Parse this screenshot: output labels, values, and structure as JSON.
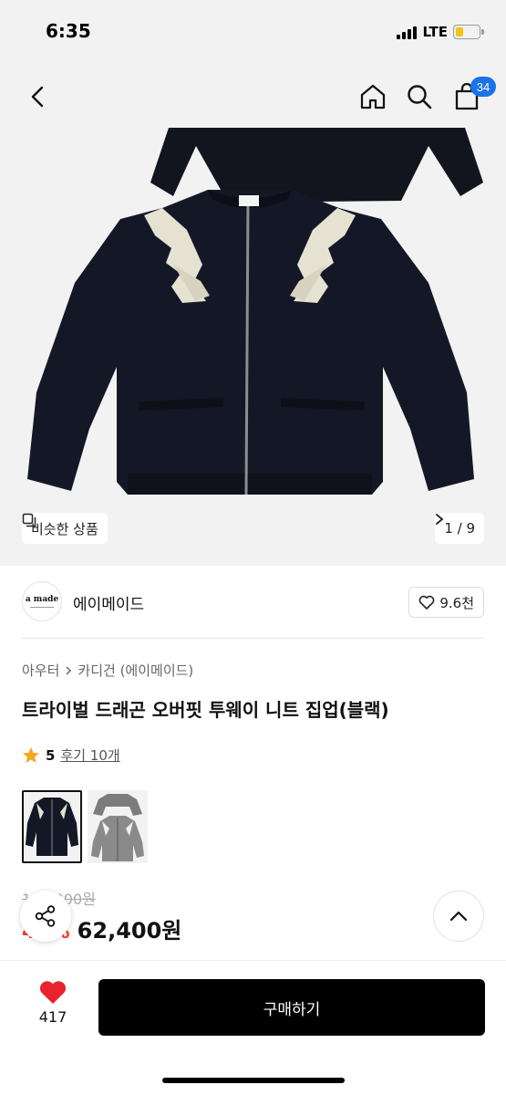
{
  "status_bar": {
    "time": "6:35",
    "network": "LTE",
    "battery_color": "#f3c31b"
  },
  "nav": {
    "back_icon": "chevron-left-icon",
    "home_icon": "home-icon",
    "search_icon": "search-icon",
    "cart_icon": "shopping-bag-icon",
    "cart_badge": "34",
    "badge_color": "#1a73e8"
  },
  "hero": {
    "similar_label": "비슷한 상품",
    "pager": "1 / 9"
  },
  "brand": {
    "logo_text": "a made",
    "name": "에이메이드",
    "likes": "9.6천"
  },
  "product": {
    "breadcrumb": [
      "아우터",
      "카디건 (에이메이드)"
    ],
    "title": "트라이벌 드래곤 오버핏 투웨이 니트 집업(블랙)",
    "rating": "5",
    "reviews": "후기 10개",
    "original_price": "104,000원",
    "discount": "40%",
    "sale_price": "62,400원",
    "color_options": [
      "블랙",
      "그레이"
    ]
  },
  "bottom": {
    "wish_count": "417",
    "buy_label": "구매하기",
    "heart_color": "#e8232d"
  }
}
